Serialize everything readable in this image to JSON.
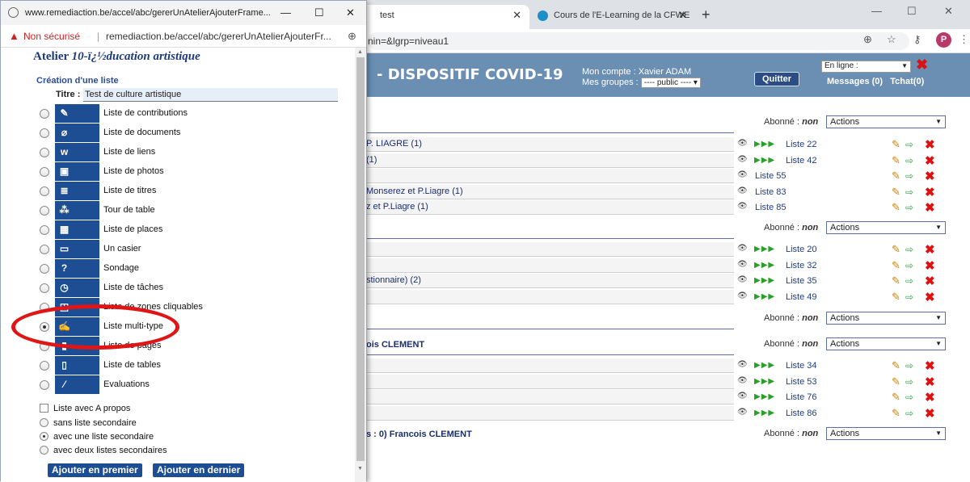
{
  "browser": {
    "tabs": [
      {
        "title": "test"
      },
      {
        "title": "Cours de l'E-Learning de la CFWE"
      }
    ],
    "new_tab": "+",
    "window_controls": {
      "minimize": "—",
      "maximize": "☐",
      "close": "✕"
    },
    "url_suffix": "nin=&lgrp=niveau1",
    "profile_initial": "P"
  },
  "site": {
    "title": "- DISPOSITIF COVID-19",
    "account_label": "Mon compte : Xavier ADAM",
    "groups_label": "Mes groupes :",
    "groups_select": "---- public ----",
    "quit_button": "Quitter",
    "status_select": "En ligne :",
    "messages": "Messages (0)",
    "chat": "Tchat(0)"
  },
  "content": {
    "subscribed_label": "Abonné :",
    "subscribed_value": "non",
    "actions_label": "Actions",
    "sections": [
      {
        "rows": [
          {
            "text": "P. LIAGRE (1)",
            "list": "Liste 22",
            "arrows": true
          },
          {
            "text": "(1)",
            "list": "Liste 42",
            "arrows": true
          },
          {
            "text": "",
            "list": "Liste 55",
            "arrows": false
          },
          {
            "text": "Monserez et P.Liagre (1)",
            "list": "Liste 83",
            "arrows": false
          },
          {
            "text": "z et P.Liagre (1)",
            "list": "Liste 85",
            "arrows": false
          }
        ]
      },
      {
        "rows": [
          {
            "text": "",
            "list": "Liste 20",
            "arrows": true
          },
          {
            "text": "",
            "list": "Liste 32",
            "arrows": true
          },
          {
            "text": "stionnaire) (2)",
            "list": "Liste 35",
            "arrows": true
          },
          {
            "text": "",
            "list": "Liste 49",
            "arrows": true
          }
        ]
      },
      {
        "rows": []
      },
      {
        "heading": "ois CLEMENT",
        "rows": [
          {
            "text": "",
            "list": "Liste 34",
            "arrows": true
          },
          {
            "text": "",
            "list": "Liste 53",
            "arrows": true
          },
          {
            "text": "",
            "list": "Liste 76",
            "arrows": true
          },
          {
            "text": "",
            "list": "Liste 86",
            "arrows": true
          }
        ]
      }
    ],
    "footer_heading": "s : 0) Francois CLEMENT"
  },
  "popup": {
    "window_title": "www.remediaction.be/accel/abc/gererUnAtelierAjouterFrame...",
    "security_label": "Non sécurisé",
    "address": "remediaction.be/accel/abc/gererUnAtelierAjouterFr...",
    "atelier_prefix": "Atelier",
    "atelier_name": "10-ï¿½ducation artistique",
    "creation_heading": "Création d'une liste",
    "title_label": "Titre :",
    "title_value": "Test de culture artistique",
    "list_types": [
      {
        "label": "Liste de contributions",
        "icon": "pencil-icon",
        "glyph": "✎"
      },
      {
        "label": "Liste de documents",
        "icon": "paperclip-icon",
        "glyph": "⌀"
      },
      {
        "label": "Liste de liens",
        "icon": "www-link-icon",
        "glyph": "w"
      },
      {
        "label": "Liste de photos",
        "icon": "photo-icon",
        "glyph": "▣"
      },
      {
        "label": "Liste de titres",
        "icon": "titles-icon",
        "glyph": "≣"
      },
      {
        "label": "Tour de table",
        "icon": "round-table-icon",
        "glyph": "⁂"
      },
      {
        "label": "Liste de places",
        "icon": "grid-places-icon",
        "glyph": "▦"
      },
      {
        "label": "Un casier",
        "icon": "locker-icon",
        "glyph": "▭"
      },
      {
        "label": "Sondage",
        "icon": "survey-icon",
        "glyph": "?"
      },
      {
        "label": "Liste de tâches",
        "icon": "clock-task-icon",
        "glyph": "◷"
      },
      {
        "label": "Liste de zones cliquables",
        "icon": "clickable-zones-icon",
        "glyph": "◰"
      },
      {
        "label": "Liste multi-type",
        "icon": "multi-type-icon",
        "glyph": "✍",
        "selected": true
      },
      {
        "label": "Liste de pages",
        "icon": "pages-icon",
        "glyph": "▮"
      },
      {
        "label": "Liste de tables",
        "icon": "tables-icon",
        "glyph": "▯"
      },
      {
        "label": "Evaluations",
        "icon": "evaluation-icon",
        "glyph": "⁄"
      }
    ],
    "about_checkbox": "Liste avec A propos",
    "secondary_options": [
      {
        "label": "sans liste secondaire",
        "selected": false
      },
      {
        "label": "avec une liste secondaire",
        "selected": true
      },
      {
        "label": "avec deux listes secondaires",
        "selected": false
      }
    ],
    "add_first_button": "Ajouter en premier",
    "add_last_button": "Ajouter en dernier"
  },
  "colors": {
    "header_blue": "#6a8fb3",
    "tile_blue": "#1d4d92",
    "annotation_red": "#e01515"
  }
}
